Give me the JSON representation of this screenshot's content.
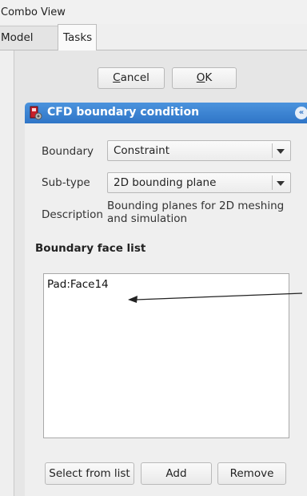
{
  "window": {
    "title": "Combo View"
  },
  "tabs": [
    {
      "label": "Model",
      "active": false
    },
    {
      "label": "Tasks",
      "active": true
    }
  ],
  "dialog_buttons": {
    "cancel_prefix": "",
    "cancel_mnemonic": "C",
    "cancel_rest": "ancel",
    "ok_prefix": "",
    "ok_mnemonic": "O",
    "ok_rest": "K"
  },
  "task_panel": {
    "title": "CFD boundary condition",
    "icon": "cfd-boundary-icon",
    "header_color": "#3a84d4"
  },
  "form": {
    "boundary_label": "Boundary",
    "boundary_value": "Constraint",
    "subtype_label": "Sub-type",
    "subtype_value": "2D bounding plane",
    "description_label": "Description",
    "description_text": "Bounding planes for 2D meshing and simulation"
  },
  "face_list": {
    "title": "Boundary face list",
    "items": [
      "Pad:Face14"
    ]
  },
  "list_buttons": {
    "select_label": "Select from list",
    "add_label": "Add",
    "remove_label": "Remove"
  }
}
